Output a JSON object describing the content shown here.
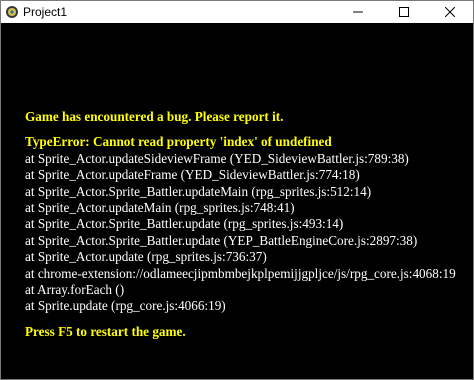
{
  "window": {
    "title": "Project1"
  },
  "error": {
    "heading": "Game has encountered a bug. Please report it.",
    "type_line": "TypeError: Cannot read property 'index' of undefined",
    "stack": [
      "at Sprite_Actor.updateSideviewFrame (YED_SideviewBattler.js:789:38)",
      "at Sprite_Actor.updateFrame (YED_SideviewBattler.js:774:18)",
      "at Sprite_Actor.Sprite_Battler.updateMain (rpg_sprites.js:512:14)",
      "at Sprite_Actor.updateMain (rpg_sprites.js:748:41)",
      "at Sprite_Actor.Sprite_Battler.update (rpg_sprites.js:493:14)",
      "at Sprite_Actor.Sprite_Battler.update (YEP_BattleEngineCore.js:2897:38)",
      "at Sprite_Actor.update (rpg_sprites.js:736:37)",
      "at chrome-extension://odlameecjipmbmbejkplpemijjgpljce/js/rpg_core.js:4068:19",
      "at Array.forEach ()",
      "at Sprite.update (rpg_core.js:4066:19)"
    ],
    "restart_hint": "Press F5 to restart the game."
  },
  "colors": {
    "background": "#000000",
    "highlight": "#ffff00",
    "text": "#ffffff"
  },
  "icons": {
    "app": "rpgmaker-app-icon",
    "minimize": "minimize-icon",
    "maximize": "maximize-icon",
    "close": "close-icon"
  }
}
